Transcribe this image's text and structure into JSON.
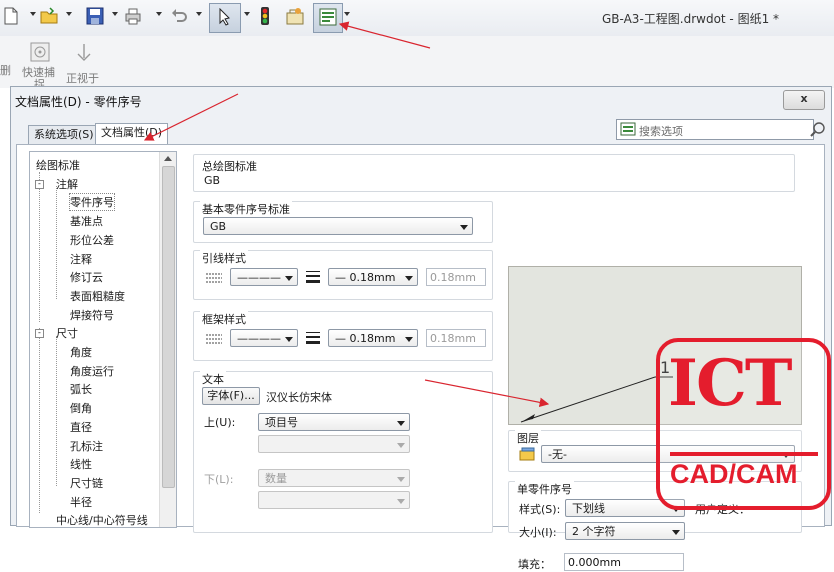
{
  "toolbar": {
    "doc_title": "GB-A3-工程图.drwdot - 图纸1 *",
    "icons": [
      "new-document-icon",
      "open-folder-icon",
      "save-icon",
      "print-icon",
      "undo-icon",
      "select-arrow-icon",
      "traffic-light-icon",
      "options-icon",
      "document-properties-icon"
    ]
  },
  "toolbar2": {
    "btn1": "快速捕",
    "btn1b": "捉",
    "btn2": "正视于",
    "left_cut": "删"
  },
  "dialog": {
    "title": "文档属性(D) - 零件序号",
    "close": "x",
    "tabs": [
      "系统选项(S)",
      "文档属性(D)"
    ],
    "search_placeholder": "搜索选项"
  },
  "tree": {
    "items": [
      {
        "label": "绘图标准",
        "level": 0
      },
      {
        "label": "注解",
        "level": 1,
        "expander": "-"
      },
      {
        "label": "零件序号",
        "level": 2
      },
      {
        "label": "基准点",
        "level": 2
      },
      {
        "label": "形位公差",
        "level": 2
      },
      {
        "label": "注释",
        "level": 2
      },
      {
        "label": "修订云",
        "level": 2
      },
      {
        "label": "表面粗糙度",
        "level": 2
      },
      {
        "label": "焊接符号",
        "level": 2
      },
      {
        "label": "尺寸",
        "level": 1,
        "expander": "-"
      },
      {
        "label": "角度",
        "level": 2
      },
      {
        "label": "角度运行",
        "level": 2
      },
      {
        "label": "弧长",
        "level": 2
      },
      {
        "label": "倒角",
        "level": 2
      },
      {
        "label": "直径",
        "level": 2
      },
      {
        "label": "孔标注",
        "level": 2
      },
      {
        "label": "线性",
        "level": 2
      },
      {
        "label": "尺寸链",
        "level": 2
      },
      {
        "label": "半径",
        "level": 2
      },
      {
        "label": "中心线/中心符号线",
        "level": 1
      }
    ]
  },
  "overall_standard": {
    "label": "总绘图标准",
    "value": "GB"
  },
  "base_standard": {
    "label": "基本零件序号标准",
    "value": "GB"
  },
  "leader_style": {
    "label": "引线样式",
    "line": "————",
    "weight": "— 0.18mm",
    "custom": "0.18mm"
  },
  "frame_style": {
    "label": "框架样式",
    "line": "————",
    "weight": "— 0.18mm",
    "custom": "0.18mm"
  },
  "text": {
    "label": "文本",
    "font_button": "字体(F)...",
    "font_name": "汉仪长仿宋体",
    "upper_label": "上(U):",
    "upper_value": "项目号",
    "lower_label": "下(L):",
    "lower_value": "数量"
  },
  "preview": {
    "balloon_number": "1"
  },
  "layer": {
    "label": "图层",
    "value": "-无-"
  },
  "single_balloon": {
    "label": "单零件序号",
    "style_label": "样式(S):",
    "style_value": "下划线",
    "size_label": "大小(I):",
    "size_value": "2 个字符",
    "user_def_label": "用户定义：",
    "padding_label": "填充：",
    "padding_value": "0.000mm"
  },
  "watermark": {
    "big": "ICT",
    "small": "CAD/CAM"
  },
  "colors": {
    "annotation_red": "#d9252f",
    "watermark_red": "#e41d2d"
  }
}
